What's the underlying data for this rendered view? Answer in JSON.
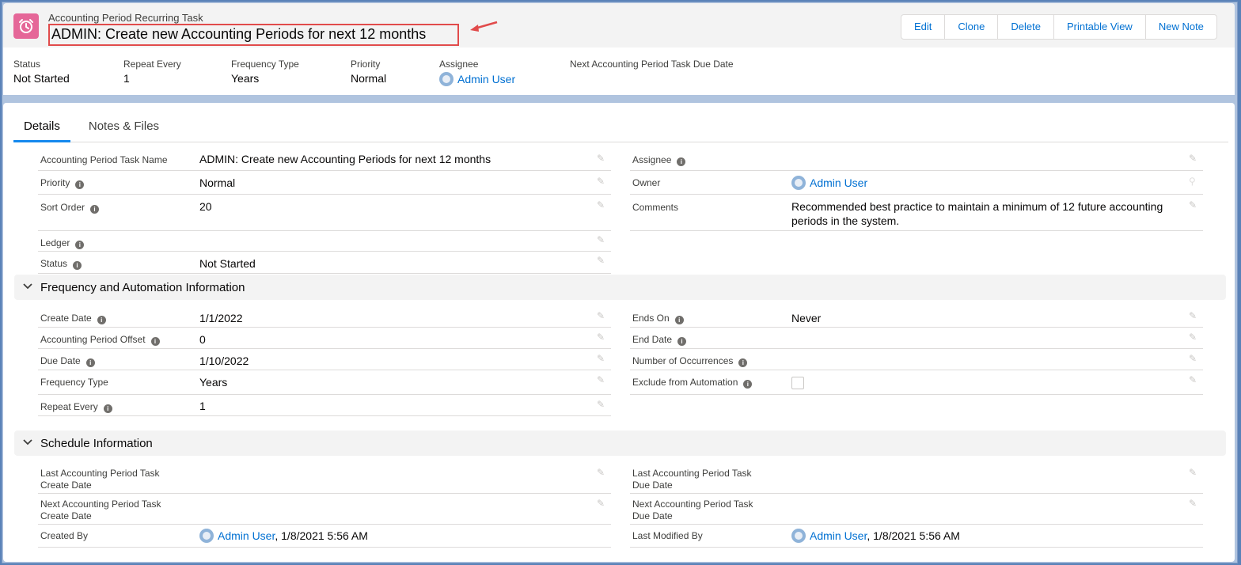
{
  "header": {
    "object_type": "Accounting Period Recurring Task",
    "title": "ADMIN: Create new Accounting Periods for next 12 months",
    "buttons": [
      "Edit",
      "Clone",
      "Delete",
      "Printable View",
      "New Note"
    ],
    "highlights": {
      "status": {
        "label": "Status",
        "value": "Not Started"
      },
      "repeat_every": {
        "label": "Repeat Every",
        "value": "1"
      },
      "frequency_type": {
        "label": "Frequency Type",
        "value": "Years"
      },
      "priority": {
        "label": "Priority",
        "value": "Normal"
      },
      "assignee": {
        "label": "Assignee",
        "value": "Admin User"
      },
      "next_due": {
        "label": "Next Accounting Period Task Due Date",
        "value": ""
      }
    },
    "colors": {
      "object_icon": "#e56798",
      "highlight_box": "#e14b4b",
      "link": "#0070d2"
    }
  },
  "tabs": [
    "Details",
    "Notes & Files"
  ],
  "details": {
    "left": [
      {
        "label": "Accounting Period Task Name",
        "value": "ADMIN: Create new Accounting Periods for next 12 months"
      },
      {
        "label": "Priority",
        "value": "Normal"
      },
      {
        "label": "Sort Order",
        "value": "20"
      },
      {
        "label": "Ledger",
        "value": ""
      },
      {
        "label": "Status",
        "value": "Not Started"
      }
    ],
    "right": [
      {
        "label": "Assignee",
        "value": ""
      },
      {
        "label": "Owner",
        "value": "Admin User"
      },
      {
        "label": "Comments",
        "value": "Recommended best practice to maintain a minimum of 12 future accounting periods in the system."
      }
    ]
  },
  "sections": {
    "frequency": {
      "title": "Frequency and Automation Information",
      "left": [
        {
          "label": "Create Date",
          "value": "1/1/2022"
        },
        {
          "label": "Accounting Period Offset",
          "value": "0"
        },
        {
          "label": "Due Date",
          "value": "1/10/2022"
        },
        {
          "label": "Frequency Type",
          "value": "Years"
        },
        {
          "label": "Repeat Every",
          "value": "1"
        }
      ],
      "right": [
        {
          "label": "Ends On",
          "value": "Never"
        },
        {
          "label": "End Date",
          "value": ""
        },
        {
          "label": "Number of Occurrences",
          "value": ""
        },
        {
          "label": "Exclude from Automation",
          "value": ""
        }
      ]
    },
    "schedule": {
      "title": "Schedule Information",
      "left": [
        {
          "label1": "Last Accounting Period Task",
          "label2": "Create Date",
          "value": ""
        },
        {
          "label1": "Next Accounting Period Task",
          "label2": "Create Date",
          "value": ""
        },
        {
          "label": "Created By",
          "user": "Admin User",
          "date": ", 1/8/2021 5:56 AM"
        }
      ],
      "right": [
        {
          "label1": "Last Accounting Period Task",
          "label2": "Due Date",
          "value": ""
        },
        {
          "label1": "Next Accounting Period Task",
          "label2": "Due Date",
          "value": ""
        },
        {
          "label": "Last Modified By",
          "user": "Admin User",
          "date": ", 1/8/2021 5:56 AM"
        }
      ]
    }
  }
}
